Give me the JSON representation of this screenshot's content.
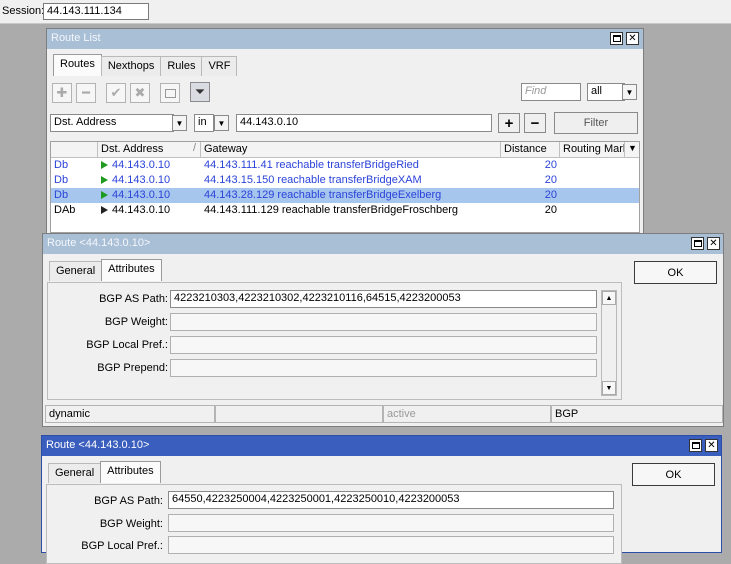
{
  "session": {
    "label": "Session:",
    "value": "44.143.111.134"
  },
  "route_list": {
    "title": "Route List",
    "tabs": [
      "Routes",
      "Nexthops",
      "Rules",
      "VRF"
    ],
    "find_placeholder": "Find",
    "filter_scope": "all",
    "filter_field": "Dst. Address",
    "filter_op": "in",
    "filter_value": "44.143.0.10",
    "filter_button": "Filter",
    "columns": [
      "",
      "Dst. Address",
      "Gateway",
      "Distance",
      "Routing Mark"
    ],
    "rows": [
      {
        "flags": "Db",
        "dst": "44.143.0.10",
        "gateway": "44.143.111.41 reachable transferBridgeRied",
        "distance": "20"
      },
      {
        "flags": "Db",
        "dst": "44.143.0.10",
        "gateway": "44.143.15.150 reachable transferBridgeXAM",
        "distance": "20"
      },
      {
        "flags": "Db",
        "dst": "44.143.0.10",
        "gateway": "44.143.28.129 reachable transferBridgeExelberg",
        "distance": "20"
      },
      {
        "flags": "DAb",
        "dst": "44.143.0.10",
        "gateway": "44.143.111.129 reachable transferBridgeFroschberg",
        "distance": "20"
      }
    ]
  },
  "route1": {
    "title": "Route <44.143.0.10>",
    "tabs": [
      "General",
      "Attributes"
    ],
    "ok_label": "OK",
    "fields": [
      {
        "label": "BGP AS Path:",
        "value": "4223210303,4223210302,4223210116,64515,4223200053"
      },
      {
        "label": "BGP Weight:",
        "value": ""
      },
      {
        "label": "BGP Local Pref.:",
        "value": ""
      },
      {
        "label": "BGP Prepend:",
        "value": ""
      }
    ],
    "status": [
      "dynamic",
      "",
      "active",
      "BGP"
    ]
  },
  "route2": {
    "title": "Route <44.143.0.10>",
    "tabs": [
      "General",
      "Attributes"
    ],
    "ok_label": "OK",
    "fields": [
      {
        "label": "BGP AS Path:",
        "value": "64550,4223250004,4223250001,4223250010,4223200053"
      },
      {
        "label": "BGP Weight:",
        "value": ""
      },
      {
        "label": "BGP Local Pref.:",
        "value": ""
      }
    ]
  },
  "icons": {
    "add": "plus-icon",
    "remove": "minus-icon",
    "enable": "check-icon",
    "disable": "x-icon",
    "comment": "note-icon",
    "filter": "funnel-icon"
  },
  "colors": {
    "active_title": "#3a5ebd",
    "inactive_title": "#a9bfd6",
    "dynamic_text": "#2b43d9",
    "selected_row": "#a6c6ee"
  }
}
